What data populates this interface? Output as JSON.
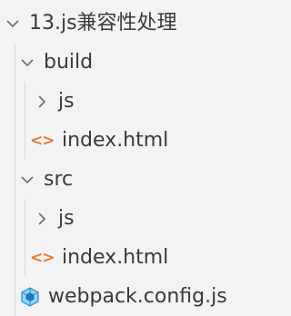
{
  "explorer": {
    "root": {
      "label": "13.js兼容性处理",
      "expanded": true,
      "icon": "chevron-down-icon"
    },
    "items": [
      {
        "label": "build",
        "expanded": true,
        "icon": "chevron-down-icon"
      },
      {
        "label": "js",
        "expanded": false,
        "icon": "chevron-right-icon"
      },
      {
        "label": "index.html",
        "icon": "html-file-icon",
        "icon_glyph": "<>",
        "icon_color": "#e37933"
      },
      {
        "label": "src",
        "expanded": true,
        "icon": "chevron-down-icon"
      },
      {
        "label": "js",
        "expanded": false,
        "icon": "chevron-right-icon"
      },
      {
        "label": "index.html",
        "icon": "html-file-icon",
        "icon_glyph": "<>",
        "icon_color": "#e37933"
      },
      {
        "label": "webpack.config.js",
        "icon": "webpack-icon",
        "icon_color": "#2f86c9"
      }
    ]
  },
  "colors": {
    "background": "#f3f3f3",
    "text": "#3a3a3a",
    "chevron": "#6b6b6b",
    "guide": "#d9d9d9"
  }
}
